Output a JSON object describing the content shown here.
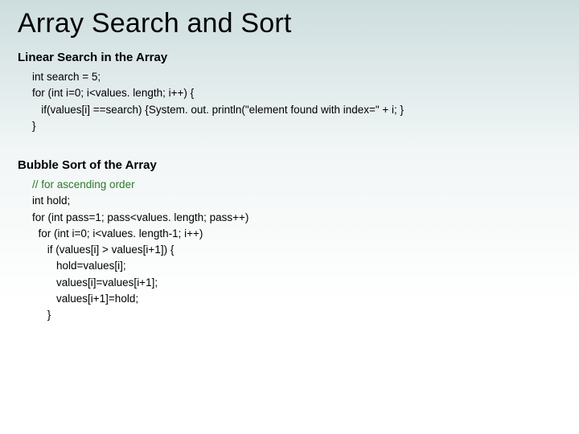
{
  "title": "Array Search and Sort",
  "sections": {
    "linear": {
      "heading": "Linear Search in the Array",
      "code": {
        "l1": "int search = 5;",
        "l2": "for (int i=0; i<values. length; i++) {",
        "l3": "   if(values[i] ==search) {System. out. println(\"element found with index=\" + i; }",
        "l4": "}"
      }
    },
    "bubble": {
      "heading": "Bubble Sort of the Array",
      "code": {
        "c1": "// for ascending order",
        "l1": "int hold;",
        "l2": "for (int pass=1; pass<values. length; pass++)",
        "l3": "  for (int i=0; i<values. length-1; i++)",
        "l4": "     if (values[i] > values[i+1]) {",
        "l5": "        hold=values[i];",
        "l6": "        values[i]=values[i+1];",
        "l7": "        values[i+1]=hold;",
        "l8": "     }"
      }
    }
  }
}
